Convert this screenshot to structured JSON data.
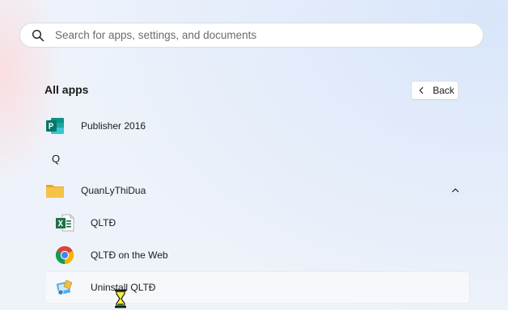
{
  "search": {
    "placeholder": "Search for apps, settings, and documents",
    "icon": "search-icon"
  },
  "header": {
    "title": "All apps",
    "back_label": "Back"
  },
  "apps": [
    {
      "label": "Publisher 2016",
      "icon": "publisher-icon"
    },
    {
      "letter": "Q"
    },
    {
      "label": "QuanLyThiDua",
      "icon": "folder-icon",
      "expanded": true
    },
    {
      "label": "QLTĐ",
      "icon": "excel-icon"
    },
    {
      "label": "QLTĐ on the Web",
      "icon": "chrome-icon"
    },
    {
      "label": "Uninstall QLTĐ",
      "icon": "uninstall-icon"
    }
  ],
  "colors": {
    "publisher": "#077568",
    "excel": "#1e7145",
    "folder": "#f6c344",
    "background": "#eef3fb"
  },
  "cursor": "busy-hourglass-icon"
}
